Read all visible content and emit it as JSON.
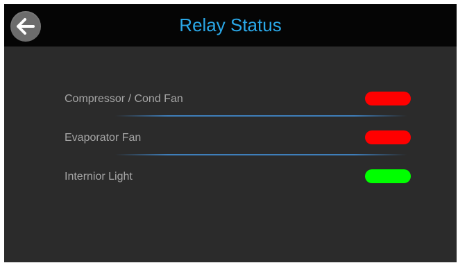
{
  "header": {
    "title": "Relay Status",
    "back_icon": "arrow-left-icon"
  },
  "colors": {
    "title": "#2aa8e8",
    "relay_off": "#ff0000",
    "relay_on": "#00ff00",
    "divider": "#428cd2",
    "background": "#2b2b2b",
    "header_background": "#050505"
  },
  "relays": [
    {
      "label": "Compressor / Cond Fan",
      "state": "off",
      "color": "#ff0000"
    },
    {
      "label": "Evaporator Fan",
      "state": "off",
      "color": "#ff0000"
    },
    {
      "label": "Internior Light",
      "state": "on",
      "color": "#00ff00"
    }
  ]
}
